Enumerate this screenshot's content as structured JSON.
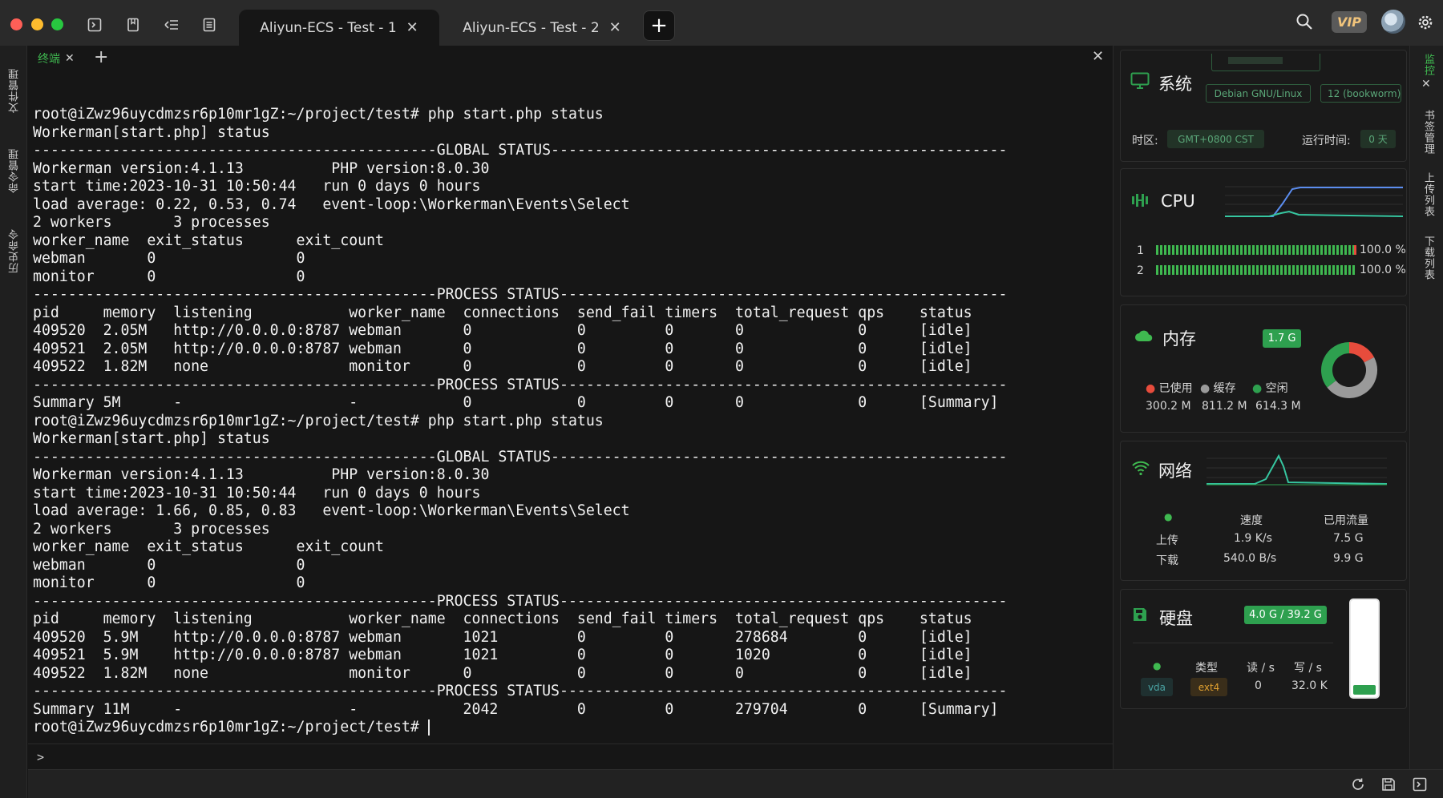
{
  "tabs": [
    {
      "label": "Aliyun-ECS - Test - 1",
      "active": true
    },
    {
      "label": "Aliyun-ECS - Test - 2",
      "active": false
    }
  ],
  "vip_label": "VIP",
  "left_rail": [
    "文件管理",
    "命令管理",
    "历史命令"
  ],
  "right_rail": [
    "监控",
    "书签管理",
    "上传列表",
    "下载列表"
  ],
  "terminal": {
    "tab_label": "终端",
    "lines": [
      "root@iZwz96uycdmzsr6p10mr1gZ:~/project/test# php start.php status",
      "Workerman[start.php] status",
      "----------------------------------------------GLOBAL STATUS----------------------------------------------------",
      "Workerman version:4.1.13          PHP version:8.0.30",
      "start time:2023-10-31 10:50:44   run 0 days 0 hours",
      "load average: 0.22, 0.53, 0.74   event-loop:\\Workerman\\Events\\Select",
      "2 workers       3 processes",
      "worker_name  exit_status      exit_count",
      "webman       0                0",
      "monitor      0                0",
      "----------------------------------------------PROCESS STATUS---------------------------------------------------",
      "pid     memory  listening           worker_name  connections  send_fail timers  total_request qps    status",
      "409520  2.05M   http://0.0.0.0:8787 webman       0            0         0       0             0      [idle]",
      "409521  2.05M   http://0.0.0.0:8787 webman       0            0         0       0             0      [idle]",
      "409522  1.82M   none                monitor      0            0         0       0             0      [idle]",
      "----------------------------------------------PROCESS STATUS---------------------------------------------------",
      "Summary 5M      -                   -            0            0         0       0             0      [Summary]",
      "root@iZwz96uycdmzsr6p10mr1gZ:~/project/test# php start.php status",
      "Workerman[start.php] status",
      "----------------------------------------------GLOBAL STATUS----------------------------------------------------",
      "Workerman version:4.1.13          PHP version:8.0.30",
      "start time:2023-10-31 10:50:44   run 0 days 0 hours",
      "load average: 1.66, 0.85, 0.83   event-loop:\\Workerman\\Events\\Select",
      "2 workers       3 processes",
      "worker_name  exit_status      exit_count",
      "webman       0                0",
      "monitor      0                0",
      "----------------------------------------------PROCESS STATUS---------------------------------------------------",
      "pid     memory  listening           worker_name  connections  send_fail timers  total_request qps    status",
      "409520  5.9M    http://0.0.0.0:8787 webman       1021         0         0       278684        0      [idle]",
      "409521  5.9M    http://0.0.0.0:8787 webman       1021         0         0       1020          0      [idle]",
      "409522  1.82M   none                monitor      0            0         0       0             0      [idle]",
      "----------------------------------------------PROCESS STATUS---------------------------------------------------",
      "Summary 11M     -                   -            2042         0         0       279704        0      [Summary]"
    ],
    "prompt_line": "root@iZwz96uycdmzsr6p10mr1gZ:~/project/test# ",
    "input_prompt": ">"
  },
  "monitor": {
    "system": {
      "title": "系统",
      "os": "Debian GNU/Linux",
      "version": "12 (bookworm)",
      "timezone_label": "时区:",
      "timezone": "GMT+0800  CST",
      "uptime_label": "运行时间:",
      "uptime": "0 天"
    },
    "cpu": {
      "title": "CPU",
      "cores": [
        {
          "label": "1",
          "value": "100.0 %",
          "fraction": 1.0
        },
        {
          "label": "2",
          "value": "100.0 %",
          "fraction": 1.0
        }
      ]
    },
    "memory": {
      "title": "内存",
      "total": "1.7 G",
      "legend": [
        "已使用",
        "缓存",
        "空闲"
      ],
      "values": [
        "300.2 M",
        "811.2 M",
        "614.3 M"
      ],
      "colors": [
        "#e74c3c",
        "#9a9a9a",
        "#2ea04f"
      ],
      "fractions": [
        0.174,
        0.47,
        0.356
      ]
    },
    "network": {
      "title": "网络",
      "col_speed": "速度",
      "col_used": "已用流量",
      "rows": [
        {
          "label": "上传",
          "speed": "1.9 K/s",
          "used": "7.5 G"
        },
        {
          "label": "下载",
          "speed": "540.0 B/s",
          "used": "9.9 G"
        }
      ]
    },
    "disk": {
      "title": "硬盘",
      "usage": "4.0 G / 39.2 G",
      "fraction": 0.102,
      "col_type": "类型",
      "col_read": "读 / s",
      "col_write": "写 / s",
      "device": "vda",
      "type": "ext4",
      "read": "0",
      "write": "32.0 K"
    }
  }
}
